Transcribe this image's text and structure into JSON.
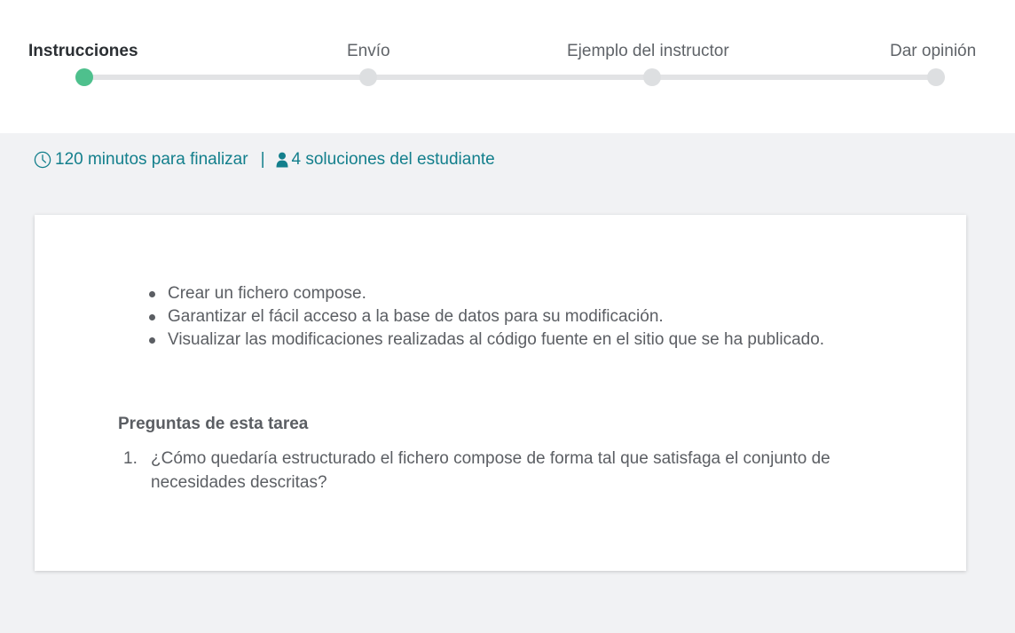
{
  "stepper": {
    "steps": [
      {
        "label": "Instrucciones",
        "active": true
      },
      {
        "label": "Envío",
        "active": false
      },
      {
        "label": "Ejemplo del instructor",
        "active": false
      },
      {
        "label": "Dar opinión",
        "active": false
      }
    ],
    "active_color": "#4ec08d",
    "inactive_color": "#dddfe1"
  },
  "meta": {
    "time_icon": "clock-icon",
    "time_text": "120 minutos para finalizar",
    "separator": "|",
    "users_icon": "user-icon",
    "solutions_text": "4 soluciones del estudiante",
    "accent_color": "#137f8c"
  },
  "card": {
    "bullets": [
      "Crear un fichero compose.",
      "Garantizar el fácil acceso a la base de datos para su modificación.",
      "Visualizar las modificaciones realizadas al código fuente en el sitio que se ha publicado."
    ],
    "questions_title": "Preguntas de esta tarea",
    "questions": [
      {
        "number": "1.",
        "text": "¿Cómo quedaría estructurado el fichero compose de forma tal que satisfaga el conjunto de necesidades descritas?"
      }
    ]
  }
}
